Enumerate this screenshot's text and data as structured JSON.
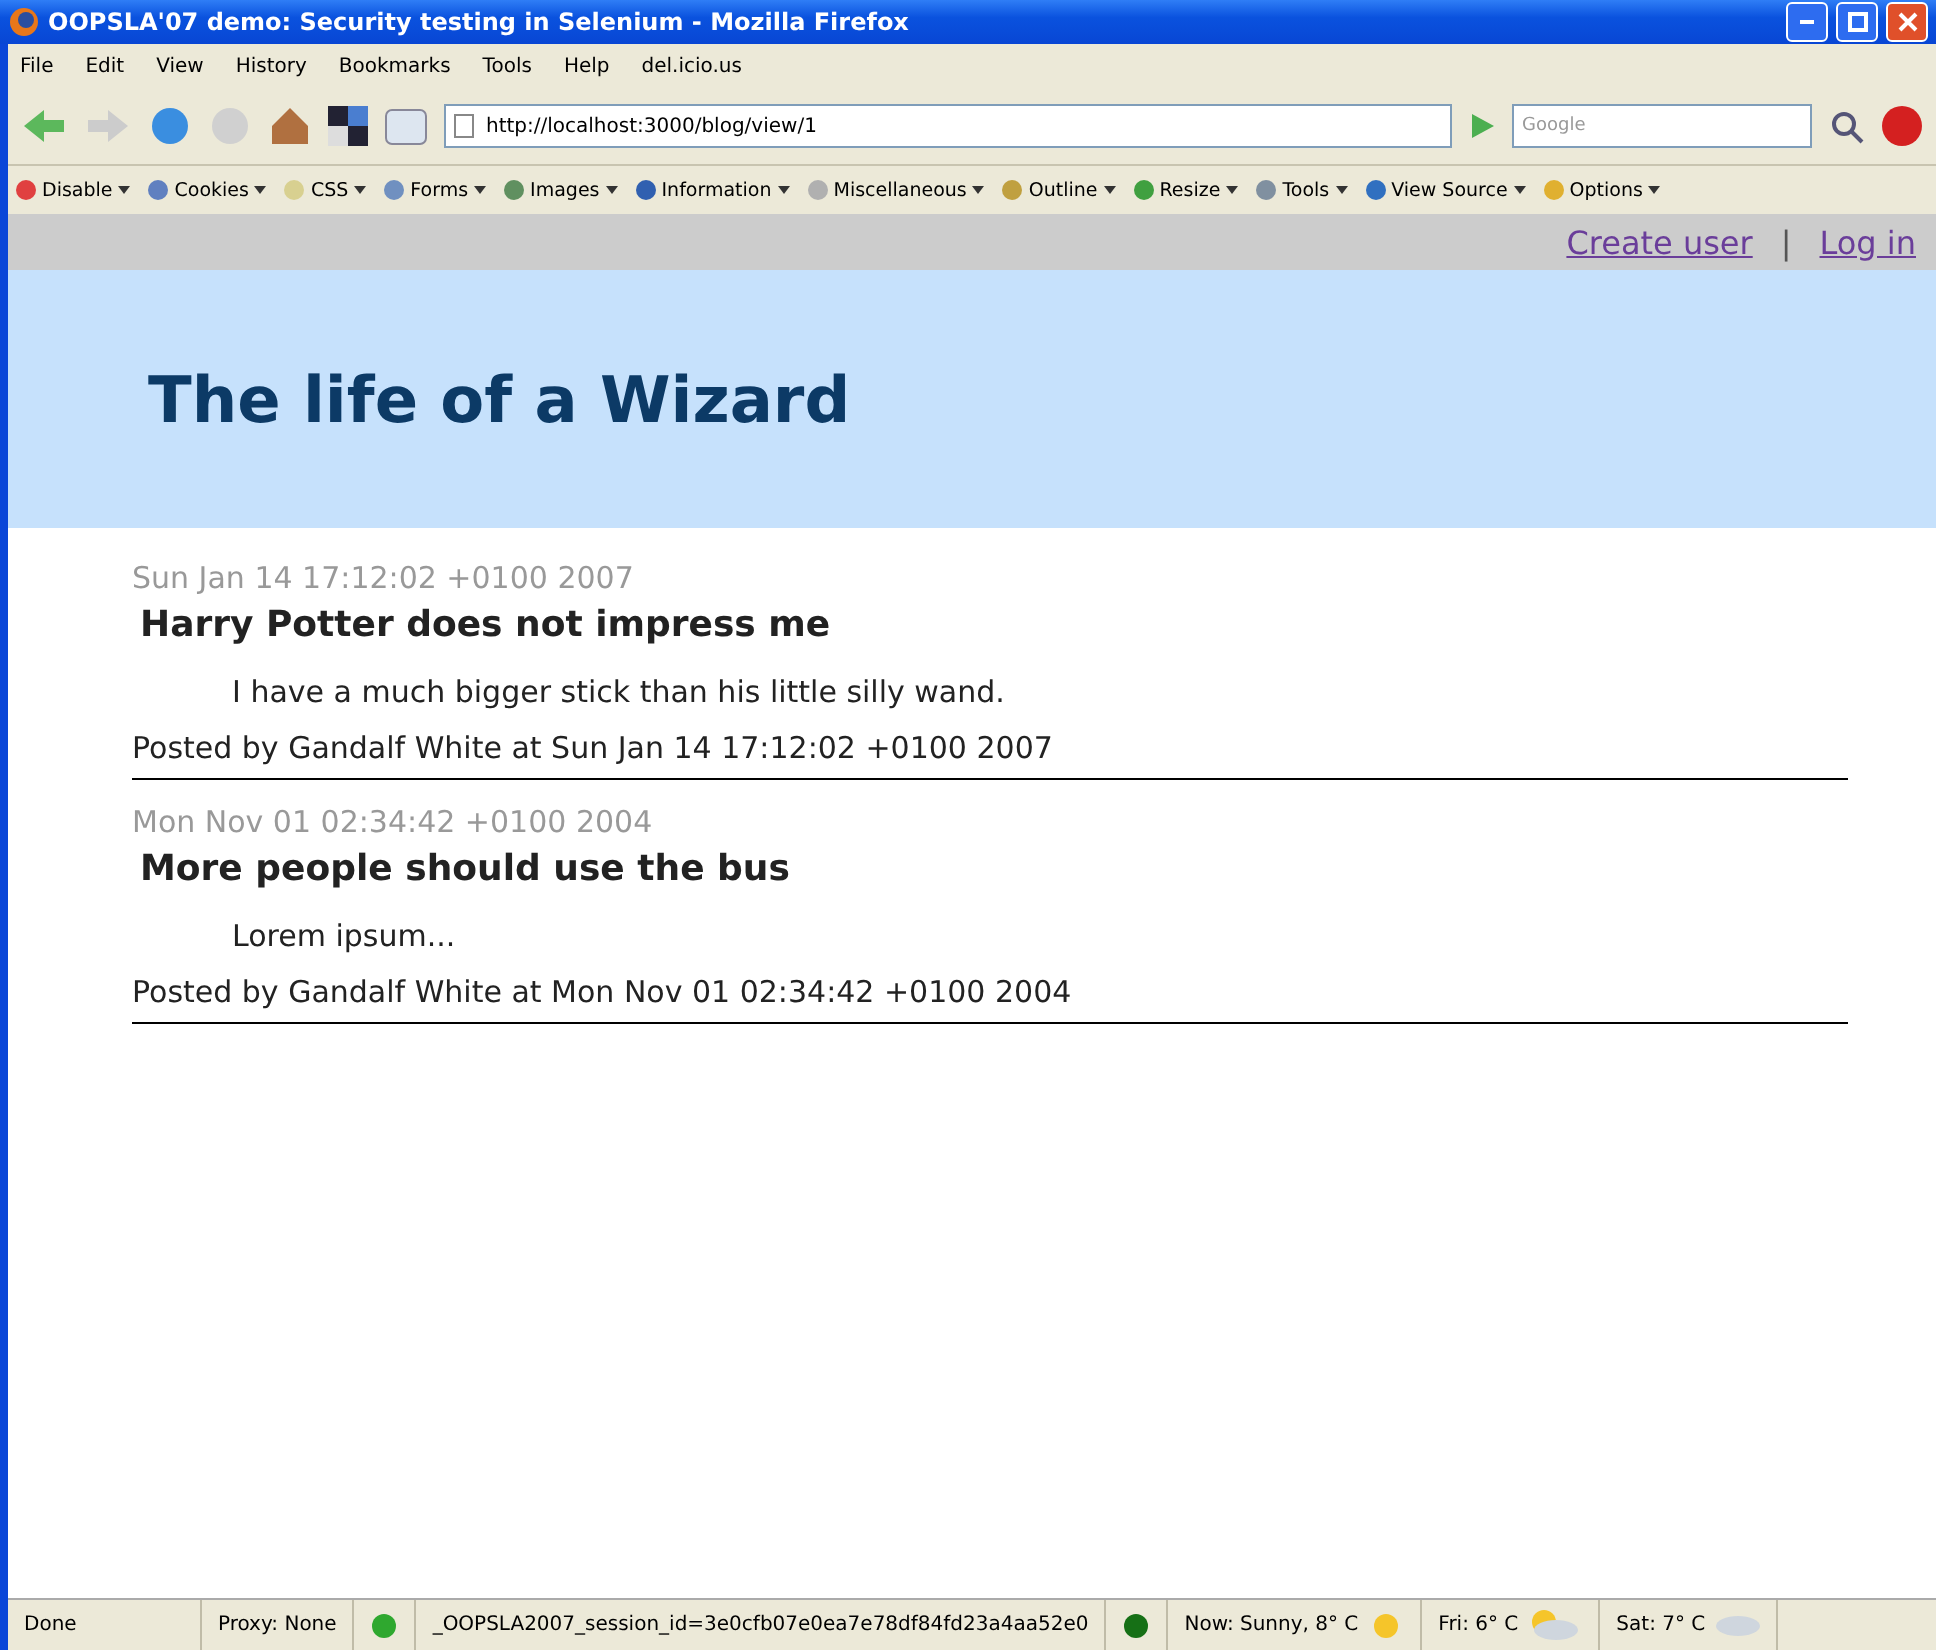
{
  "window": {
    "title": "OOPSLA'07 demo: Security testing in Selenium - Mozilla Firefox"
  },
  "menu": [
    "File",
    "Edit",
    "View",
    "History",
    "Bookmarks",
    "Tools",
    "Help",
    "del.icio.us"
  ],
  "address": {
    "value": "http://localhost:3000/blog/view/1"
  },
  "search": {
    "placeholder": "Google"
  },
  "dev_toolbar": [
    {
      "label": "Disable",
      "color": "#e04040"
    },
    {
      "label": "Cookies",
      "color": "#6080c0"
    },
    {
      "label": "CSS",
      "color": "#d8d090"
    },
    {
      "label": "Forms",
      "color": "#7090c0"
    },
    {
      "label": "Images",
      "color": "#609060"
    },
    {
      "label": "Information",
      "color": "#3060b0"
    },
    {
      "label": "Miscellaneous",
      "color": "#b0b0b0"
    },
    {
      "label": "Outline",
      "color": "#c0a040"
    },
    {
      "label": "Resize",
      "color": "#40a040"
    },
    {
      "label": "Tools",
      "color": "#8090a0"
    },
    {
      "label": "View Source",
      "color": "#3070c0"
    },
    {
      "label": "Options",
      "color": "#e0b030"
    }
  ],
  "user_links": [
    "Create user",
    "Log in"
  ],
  "user_links_separator": "|",
  "site_title": "The life of a Wizard",
  "posts": [
    {
      "date": "Sun Jan 14 17:12:02 +0100 2007",
      "title": "Harry Potter does not impress me",
      "body": "I have a much bigger stick than his little silly wand.",
      "byline": "Posted by Gandalf White at Sun Jan 14 17:12:02 +0100 2007"
    },
    {
      "date": "Mon Nov 01 02:34:42 +0100 2004",
      "title": "More people should use the bus",
      "body": "Lorem ipsum...",
      "byline": "Posted by Gandalf White at Mon Nov 01 02:34:42 +0100 2004"
    }
  ],
  "status_bar": {
    "state": "Done",
    "proxy": "Proxy: None",
    "cookie": "_OOPSLA2007_session_id=3e0cfb07e0ea7e78df84fd23a4aa52e0",
    "weather": [
      "Now: Sunny, 8° C",
      "Fri: 6° C",
      "Sat: 7° C"
    ]
  }
}
